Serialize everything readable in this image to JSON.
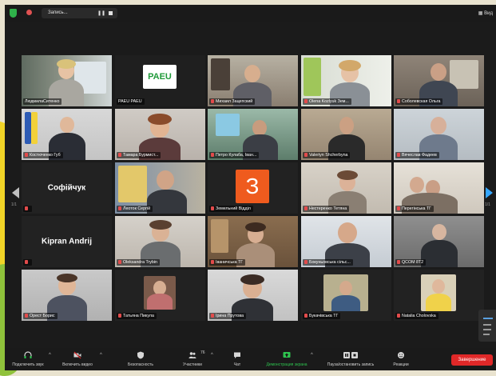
{
  "topbar": {
    "record_label": "Запись...",
    "view_label": "Вид"
  },
  "gallery": {
    "tiles": [
      {
        "name": "ЛюдмилаСитенко",
        "muted": false,
        "speaking": true
      },
      {
        "name": "PAEU PAEU",
        "muted": false
      },
      {
        "name": "Михаил Зацепский",
        "muted": true
      },
      {
        "name": "Olena Kozlyuk Зем...",
        "muted": true
      },
      {
        "name": "Соболевская Ольга",
        "muted": true
      },
      {
        "name": "Костюченко Губ",
        "muted": true
      },
      {
        "name": "Тамара Бурмист...",
        "muted": true
      },
      {
        "name": "Петро Кулаба, Іван...",
        "muted": true
      },
      {
        "name": "Valeriyn Shcherbyna",
        "muted": true
      },
      {
        "name": "Вячеслав Фадеев",
        "muted": true
      },
      {
        "name": "",
        "muted": true,
        "big_name": "Софійчук"
      },
      {
        "name": "Леоток Сергій",
        "muted": true
      },
      {
        "name": "Земельний Відділ",
        "muted": true,
        "avatar_letter": "З"
      },
      {
        "name": "Нестеренко Тетяна",
        "muted": true
      },
      {
        "name": "Перегінська ТГ",
        "muted": true
      },
      {
        "name": "",
        "muted": true,
        "big_name": "Kipran Andrij"
      },
      {
        "name": "Oleksandra Trybin",
        "muted": true
      },
      {
        "name": "Іваничська ТГ",
        "muted": true
      },
      {
        "name": "Бокуньовська сільс...",
        "muted": true
      },
      {
        "name": "QCOM 8T2",
        "muted": true
      },
      {
        "name": "Орест Борис",
        "muted": true
      },
      {
        "name": "Татьяна Пикула",
        "muted": true
      },
      {
        "name": "Ірина Прутова",
        "muted": true
      },
      {
        "name": "Букачівська ТГ",
        "muted": true
      },
      {
        "name": "Natalia Cholovska",
        "muted": true
      }
    ],
    "page_left": "1/1",
    "page_right": "1/1"
  },
  "toolbar": {
    "audio": "Подключить звук",
    "video": "Включить видео",
    "security": "Безопасность",
    "participants": "Участники",
    "participants_count": "76",
    "chat": "Чат",
    "share": "Демонстрация экрана",
    "pause_record": "Пауза/остановить запись",
    "reactions": "Реакции",
    "end": "Завершение"
  },
  "colors": {
    "accent_green": "#2ec44f",
    "end_red": "#e02828",
    "speaker_yellow": "#d9e021"
  }
}
